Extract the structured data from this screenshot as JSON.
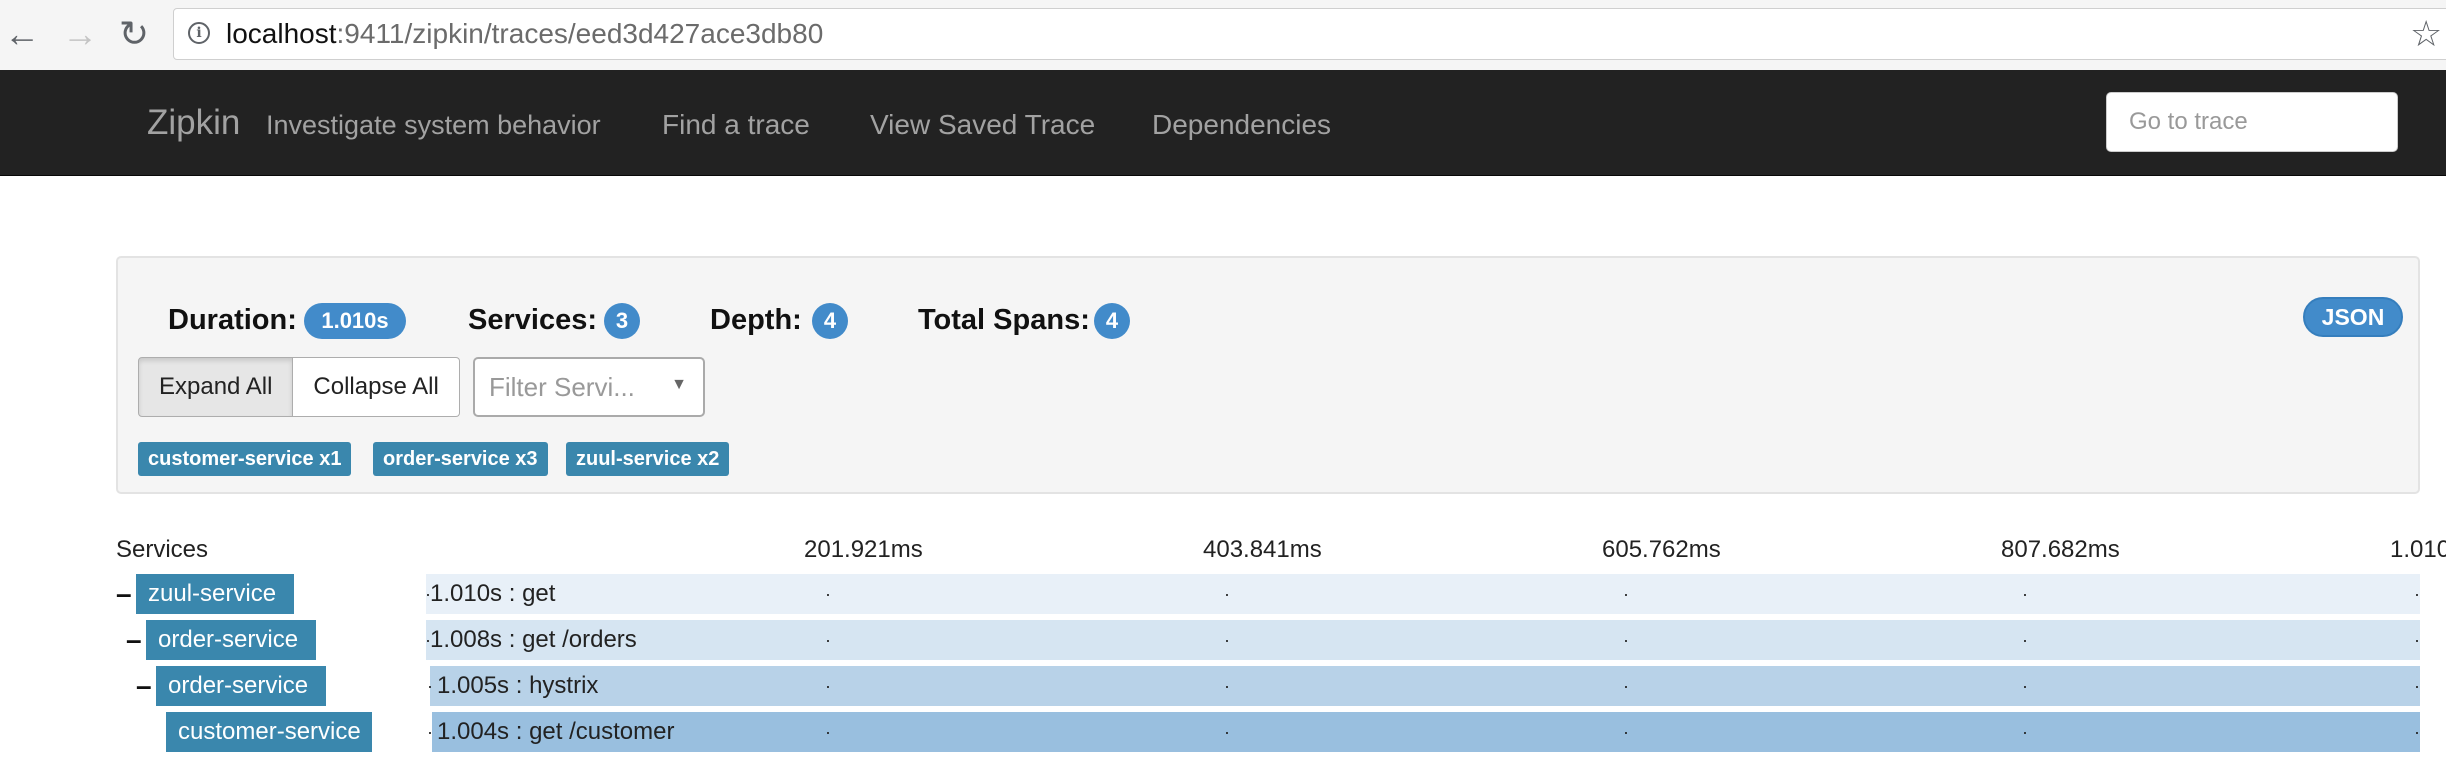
{
  "browser": {
    "url_host": "localhost",
    "url_rest": ":9411/zipkin/traces/eed3d427ace3db80",
    "back_icon": "arrow-left-icon",
    "forward_icon": "arrow-right-icon",
    "reload_icon": "reload-icon",
    "info_icon": "info-icon",
    "star_icon": "star-icon",
    "back_glyph": "←",
    "forward_glyph": "→",
    "reload_glyph": "↻",
    "info_glyph": "i",
    "star_glyph": "☆"
  },
  "navbar": {
    "brand": "Zipkin",
    "tagline": "Investigate system behavior",
    "links": [
      "Find a trace",
      "View Saved Trace",
      "Dependencies"
    ],
    "goto_placeholder": "Go to trace"
  },
  "summary": {
    "duration_label": "Duration:",
    "duration_value": "1.010s",
    "services_label": "Services:",
    "services_value": "3",
    "depth_label": "Depth:",
    "depth_value": "4",
    "total_spans_label": "Total Spans:",
    "total_spans_value": "4",
    "json_label": "JSON",
    "expand_all": "Expand All",
    "collapse_all": "Collapse All",
    "filter_placeholder": "Filter Servi...",
    "filter_caret": "▼",
    "service_tags": [
      "customer-service x1",
      "order-service x3",
      "zuul-service x2"
    ]
  },
  "timeline": {
    "services_header": "Services",
    "ticks": [
      "201.921ms",
      "403.841ms",
      "605.762ms",
      "807.682ms",
      "1.010"
    ],
    "dot": "·",
    "collapse_glyph": "–",
    "spans": [
      {
        "service": "zuul-service",
        "label": "1.010s : get",
        "collapsible": true
      },
      {
        "service": "order-service",
        "label": "1.008s : get /orders",
        "collapsible": true
      },
      {
        "service": "order-service",
        "label": "1.005s : hystrix",
        "collapsible": true
      },
      {
        "service": "customer-service",
        "label": "1.004s : get /customer",
        "collapsible": false
      }
    ]
  },
  "colors": {
    "navbar_bg": "#222222",
    "badge": "#428bca",
    "service_tag": "#3a87ad",
    "span_depth_1": "#e8f0f8",
    "span_depth_2": "#d6e5f2",
    "span_depth_3": "#b8d2e8",
    "span_depth_4": "#99bfdf"
  }
}
